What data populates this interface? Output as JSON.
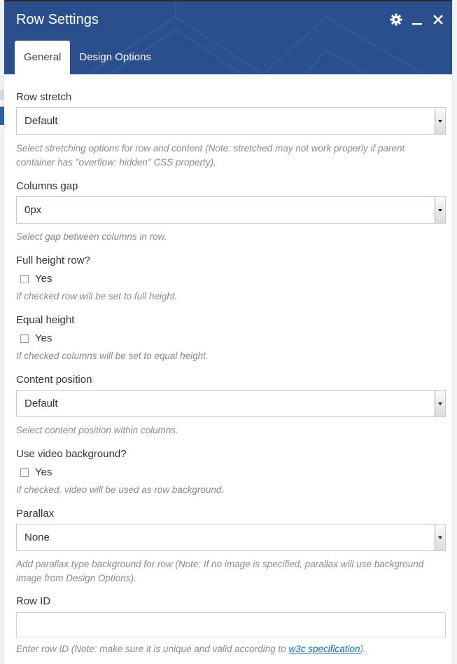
{
  "dialog": {
    "title": "Row Settings",
    "icons": [
      "gear-icon",
      "minimize-icon",
      "close-icon"
    ],
    "tabs": [
      {
        "label": "General",
        "active": true
      },
      {
        "label": "Design Options",
        "active": false
      }
    ],
    "colors": {
      "header": "#2a4f8c",
      "link": "#0a6ea8"
    }
  },
  "fields": {
    "row_stretch": {
      "label": "Row stretch",
      "value": "Default",
      "help": "Select stretching options for row and content (Note: stretched may not work properly if parent container has \"overflow: hidden\" CSS property)."
    },
    "columns_gap": {
      "label": "Columns gap",
      "value": "0px",
      "help": "Select gap between columns in row."
    },
    "full_height": {
      "label": "Full height row?",
      "checkbox_label": "Yes",
      "checked": false,
      "help": "If checked row will be set to full height."
    },
    "equal_height": {
      "label": "Equal height",
      "checkbox_label": "Yes",
      "checked": false,
      "help": "If checked columns will be set to equal height."
    },
    "content_position": {
      "label": "Content position",
      "value": "Default",
      "help": "Select content position within columns."
    },
    "video_bg": {
      "label": "Use video background?",
      "checkbox_label": "Yes",
      "checked": false,
      "help": "If checked, video will be used as row background."
    },
    "parallax": {
      "label": "Parallax",
      "value": "None",
      "help": "Add parallax type background for row (Note: If no image is specified, parallax will use background image from Design Options)."
    },
    "row_id": {
      "label": "Row ID",
      "value": "",
      "help_before": "Enter row ID (Note: make sure it is unique and valid according to ",
      "help_link": "w3c specification",
      "help_after": ")."
    }
  }
}
